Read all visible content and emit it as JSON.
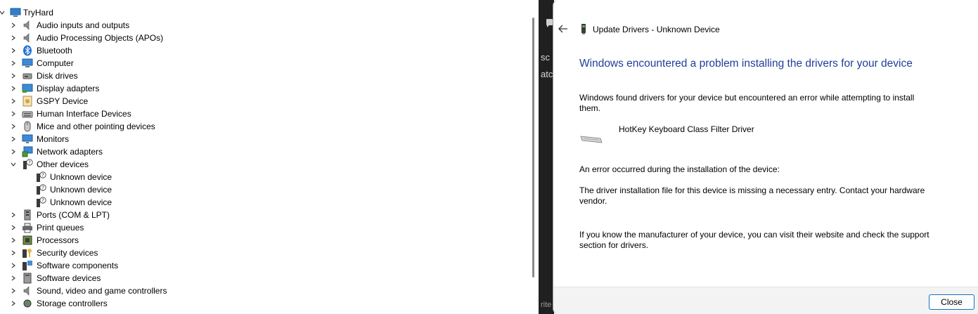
{
  "device_manager": {
    "root": "TryHard",
    "categories": [
      {
        "label": "Audio inputs and outputs",
        "icon": "speaker-icon"
      },
      {
        "label": "Audio Processing Objects (APOs)",
        "icon": "speaker-icon"
      },
      {
        "label": "Bluetooth",
        "icon": "bluetooth-icon"
      },
      {
        "label": "Computer",
        "icon": "computer-icon"
      },
      {
        "label": "Disk drives",
        "icon": "disk-drive-icon"
      },
      {
        "label": "Display adapters",
        "icon": "display-adapter-icon"
      },
      {
        "label": "GSPY Device",
        "icon": "gspy-device-icon"
      },
      {
        "label": "Human Interface Devices",
        "icon": "hid-icon"
      },
      {
        "label": "Mice and other pointing devices",
        "icon": "mouse-icon"
      },
      {
        "label": "Monitors",
        "icon": "monitor-icon"
      },
      {
        "label": "Network adapters",
        "icon": "network-adapter-icon"
      },
      {
        "label": "Other devices",
        "icon": "unknown-device-icon",
        "expanded": true,
        "children": [
          "Unknown device",
          "Unknown device",
          "Unknown device"
        ]
      },
      {
        "label": "Ports (COM & LPT)",
        "icon": "port-icon"
      },
      {
        "label": "Print queues",
        "icon": "printer-icon"
      },
      {
        "label": "Processors",
        "icon": "processor-icon"
      },
      {
        "label": "Security devices",
        "icon": "security-device-icon"
      },
      {
        "label": "Software components",
        "icon": "software-component-icon"
      },
      {
        "label": "Software devices",
        "icon": "software-device-icon"
      },
      {
        "label": "Sound, video and game controllers",
        "icon": "sound-icon"
      },
      {
        "label": "Storage controllers",
        "icon": "storage-controller-icon"
      }
    ]
  },
  "background_fragments": [
    "sc",
    "atc",
    "rite"
  ],
  "dialog": {
    "title": "Update Drivers - Unknown Device",
    "heading": "Windows encountered a problem installing the drivers for your device",
    "found_text": "Windows found drivers for your device but encountered an error while attempting to install them.",
    "driver_name": "HotKey Keyboard Class Filter Driver",
    "error_intro": "An error occurred during the installation of the device:",
    "error_detail": "The driver installation file for this device is missing a necessary entry. Contact your hardware vendor.",
    "advice": "If you know the manufacturer of your device, you can visit their website and check the support section for drivers.",
    "close_label": "Close"
  },
  "colors": {
    "heading_blue": "#1f3f9a",
    "close_border": "#1a6fc4",
    "dark_panel": "#202020"
  }
}
